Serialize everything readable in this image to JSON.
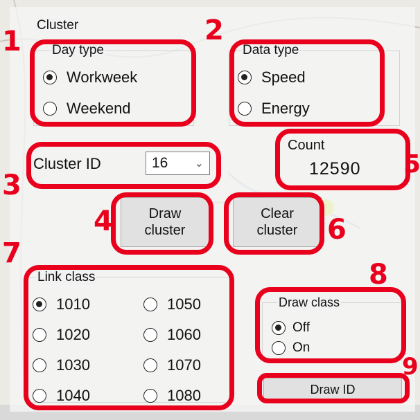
{
  "panel": {
    "title": "Cluster",
    "day_type": {
      "label": "Day type",
      "options": [
        "Workweek",
        "Weekend"
      ],
      "selected": "Workweek"
    },
    "data_type": {
      "label": "Data type",
      "options": [
        "Speed",
        "Energy"
      ],
      "selected": "Speed"
    },
    "cluster_id": {
      "label": "Cluster ID",
      "value": "16"
    },
    "count": {
      "label": "Count",
      "value": "12590"
    },
    "buttons": {
      "draw_cluster": [
        "Draw",
        "cluster"
      ],
      "clear_cluster": [
        "Clear",
        "cluster"
      ],
      "draw_id": "Draw ID"
    },
    "link_class": {
      "label": "Link class",
      "options": [
        "1010",
        "1050",
        "1020",
        "1060",
        "1030",
        "1070",
        "1040",
        "1080"
      ],
      "selected": "1010"
    },
    "draw_class": {
      "label": "Draw class",
      "options": [
        "Off",
        "On"
      ],
      "selected": "Off"
    }
  },
  "annotations": [
    "1",
    "2",
    "3",
    "4",
    "5",
    "6",
    "7",
    "8",
    "9"
  ],
  "colors": {
    "annotation": "#e8001c",
    "map_accent": "#d4e633"
  }
}
